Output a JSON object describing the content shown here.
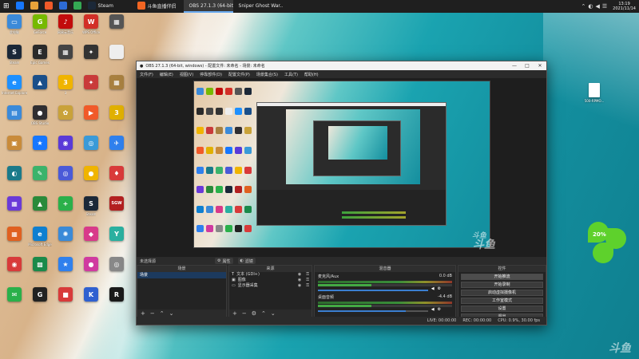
{
  "taskbar": {
    "tasks": [
      {
        "label": "",
        "color": "#1677ff"
      },
      {
        "label": "",
        "color": "#e8a33a"
      },
      {
        "label": "",
        "color": "#f15a29"
      },
      {
        "label": "",
        "color": "#2d6bd6"
      },
      {
        "label": "",
        "color": "#34a853"
      },
      {
        "label": "Steam",
        "color": "#1b2838"
      },
      {
        "label": "斗鱼直播伴侣",
        "color": "#f26522"
      },
      {
        "label": "OBS 27.1.3 (64-bit...",
        "color": "#302e31"
      },
      {
        "label": "Sniper Ghost War...",
        "color": "#7a1c1c"
      }
    ],
    "clock_time": "13:19",
    "clock_date": "2021/11/14"
  },
  "desktop": {
    "icons": [
      {
        "label": "此电脑",
        "glyph": "▭",
        "color": "#3b8ad9"
      },
      {
        "label": "GeForce",
        "glyph": "G",
        "color": "#76b900"
      },
      {
        "label": "网易云音乐",
        "glyph": "♪",
        "color": "#c20c0c"
      },
      {
        "label": "WPS Office",
        "glyph": "W",
        "color": "#d22f27"
      },
      {
        "label": "",
        "glyph": "▦",
        "color": "#555555"
      },
      {
        "label": "Steam",
        "glyph": "S",
        "color": "#1b2838"
      },
      {
        "label": "Epic Games",
        "glyph": "E",
        "color": "#2a2a2a"
      },
      {
        "label": "",
        "glyph": "▦",
        "color": "#444444"
      },
      {
        "label": "",
        "glyph": "✦",
        "color": "#333333"
      },
      {
        "label": "",
        "glyph": "",
        "color": "#eeeeee"
      },
      {
        "label": "Internet Explorer",
        "glyph": "e",
        "color": "#1e90ff"
      },
      {
        "label": "",
        "glyph": "▲",
        "color": "#1a4f8a"
      },
      {
        "label": "3",
        "glyph": "3",
        "color": "#f0b400"
      },
      {
        "label": "",
        "glyph": "✦",
        "color": "#c93a3a"
      },
      {
        "label": "",
        "glyph": "▦",
        "color": "#a88040"
      },
      {
        "label": "",
        "glyph": "▤",
        "color": "#3b8ad9"
      },
      {
        "label": "OBS Studio",
        "glyph": "●",
        "color": "#302e31"
      },
      {
        "label": "",
        "glyph": "✿",
        "color": "#c9a23a"
      },
      {
        "label": "",
        "glyph": "▶",
        "color": "#f15a29"
      },
      {
        "label": "",
        "glyph": "3",
        "color": "#e0b000"
      },
      {
        "label": "",
        "glyph": "▣",
        "color": "#c98b3a"
      },
      {
        "label": "",
        "glyph": "★",
        "color": "#1677ff"
      },
      {
        "label": "",
        "glyph": "◉",
        "color": "#5a3ad8"
      },
      {
        "label": "",
        "glyph": "◎",
        "color": "#3a9ad8"
      },
      {
        "label": "",
        "glyph": "✈",
        "color": "#2f80ed"
      },
      {
        "label": "",
        "glyph": "◐",
        "color": "#1a7a8a"
      },
      {
        "label": "",
        "glyph": "✎",
        "color": "#3bb36b"
      },
      {
        "label": "",
        "glyph": "◎",
        "color": "#4a5ad8"
      },
      {
        "label": "",
        "glyph": "●",
        "color": "#f0b400"
      },
      {
        "label": "",
        "glyph": "♦",
        "color": "#d93a3a"
      },
      {
        "label": "",
        "glyph": "▦",
        "color": "#6a3ad8"
      },
      {
        "label": "",
        "glyph": "▲",
        "color": "#2a8a3a"
      },
      {
        "label": "",
        "glyph": "+",
        "color": "#2ab04a"
      },
      {
        "label": "Steam",
        "glyph": "S",
        "color": "#1b2838"
      },
      {
        "label": "",
        "glyph": "SGW",
        "color": "#b32020"
      },
      {
        "label": "",
        "glyph": "▦",
        "color": "#e06020"
      },
      {
        "label": "Microsoft Edge",
        "glyph": "e",
        "color": "#0f7fd0"
      },
      {
        "label": "",
        "glyph": "✺",
        "color": "#3a8ad8"
      },
      {
        "label": "",
        "glyph": "◆",
        "color": "#d83a8a"
      },
      {
        "label": "",
        "glyph": "Y",
        "color": "#2ab0a0"
      },
      {
        "label": "",
        "glyph": "◉",
        "color": "#d83a3a"
      },
      {
        "label": "",
        "glyph": "▩",
        "color": "#1a8a4a"
      },
      {
        "label": "",
        "glyph": "★",
        "color": "#2f80ed"
      },
      {
        "label": "",
        "glyph": "●",
        "color": "#d03aa0"
      },
      {
        "label": "",
        "glyph": "◎",
        "color": "#888888"
      },
      {
        "label": "",
        "glyph": "✉",
        "color": "#2ab04a"
      },
      {
        "label": "",
        "glyph": "G",
        "color": "#222222"
      },
      {
        "label": "",
        "glyph": "■",
        "color": "#d83a3a"
      },
      {
        "label": "",
        "glyph": "K",
        "color": "#2f60d0"
      },
      {
        "label": "",
        "glyph": "R",
        "color": "#1a1a1a"
      }
    ]
  },
  "right_desktop": {
    "file_label": "500-RPMO...",
    "percent": "20%"
  },
  "obs": {
    "title": "OBS 27.1.3 (64-bit, windows) - 配置文件: 未命名 - 场景: 未命名",
    "menu": [
      "文件(F)",
      "编辑(E)",
      "视图(V)",
      "停靠部件(D)",
      "配置文件(P)",
      "场景集合(S)",
      "工具(T)",
      "帮助(H)"
    ],
    "mid_bar": {
      "label": "未选择源",
      "properties": "属性",
      "filters": "滤镜"
    },
    "docks": {
      "scenes": {
        "header": "场景",
        "items": [
          "场景"
        ]
      },
      "sources": {
        "header": "来源",
        "items": [
          "文本 (GDI+)",
          "图像",
          "显示器采集"
        ]
      },
      "mixer": {
        "header": "混音器",
        "channels": [
          {
            "name": "麦克风/Aux",
            "db": "0.0 dB",
            "level": 1.0
          },
          {
            "name": "桌面音频",
            "db": "-4.4 dB",
            "level": 0.8
          }
        ]
      },
      "controls": {
        "header": "控件",
        "buttons": [
          "开始推流",
          "开始录制",
          "启动虚拟摄像机",
          "工作室模式",
          "设置",
          "退出"
        ]
      }
    },
    "status": {
      "live": "LIVE: 00:00:00",
      "rec": "REC: 00:00:00",
      "cpu": "CPU: 0.9%, 30.00 fps"
    }
  }
}
